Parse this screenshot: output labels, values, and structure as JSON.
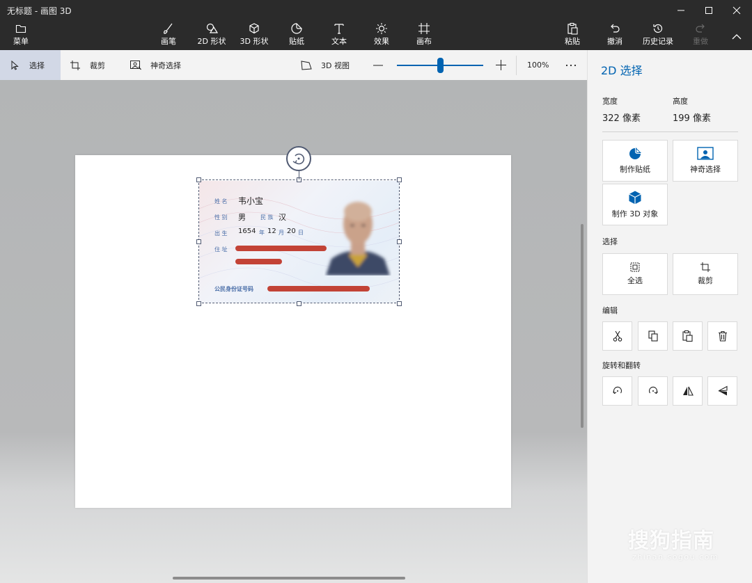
{
  "window": {
    "title": "无标题 - 画图 3D"
  },
  "ribbon": {
    "menu": "菜单",
    "tools": [
      {
        "key": "brush",
        "label": "画笔",
        "icon": "brush-icon"
      },
      {
        "key": "shapes2d",
        "label": "2D 形状",
        "icon": "shapes-2d-icon"
      },
      {
        "key": "shapes3d",
        "label": "3D 形状",
        "icon": "cube-icon"
      },
      {
        "key": "stickers",
        "label": "贴纸",
        "icon": "sticker-icon"
      },
      {
        "key": "text",
        "label": "文本",
        "icon": "text-icon"
      },
      {
        "key": "effects",
        "label": "效果",
        "icon": "sun-icon"
      },
      {
        "key": "canvas",
        "label": "画布",
        "icon": "canvas-icon"
      }
    ],
    "paste": "粘贴",
    "undo": "撤消",
    "history": "历史记录",
    "redo": "重做"
  },
  "toolbar": {
    "select": "选择",
    "crop": "裁剪",
    "magic_select": "神奇选择",
    "view3d": "3D 视图",
    "zoom_percent": 100,
    "zoom_label": "100%",
    "zoom_fraction": 0.5
  },
  "idcard": {
    "name_label": "姓 名",
    "name": "韦小宝",
    "sex_label": "性 别",
    "sex": "男",
    "ethnic_label": "民 族",
    "ethnic": "汉",
    "birth_label": "出 生",
    "birth_year": "1654",
    "year_char": "年",
    "birth_month": "12",
    "month_char": "月",
    "birth_day": "20",
    "day_char": "日",
    "address_label": "住 址",
    "id_label": "公民身份证号码"
  },
  "panel": {
    "title": "2D 选择",
    "width_label": "宽度",
    "width_value": "322 像素",
    "height_label": "高度",
    "height_value": "199 像素",
    "make_sticker": "制作贴纸",
    "magic_select": "神奇选择",
    "make_3d": "制作 3D 对象",
    "select_section": "选择",
    "select_all": "全选",
    "crop": "裁剪",
    "edit_section": "编辑",
    "rotate_section": "旋转和翻转"
  },
  "watermark": {
    "logo": "搜狗指南",
    "url": "zhinan.sogou.com"
  },
  "colors": {
    "accent": "#0063b1",
    "dark_bar": "#2b2b2b",
    "select_highlight": "#d2d8e6"
  }
}
